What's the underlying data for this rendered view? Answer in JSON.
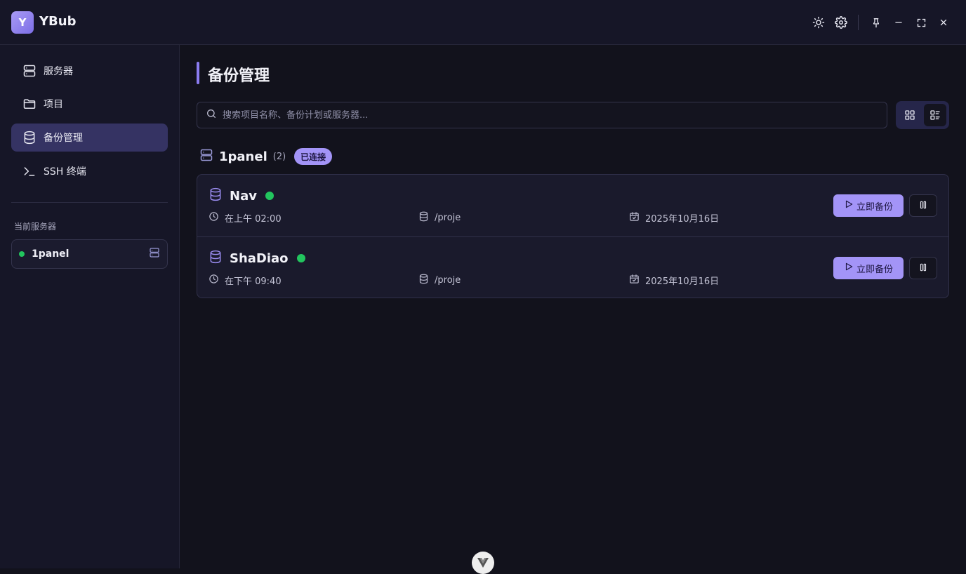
{
  "app": {
    "logo_letter": "Y",
    "name": "YBub"
  },
  "titlebar": {
    "icons": [
      "sun-icon",
      "gear-icon",
      "pin-icon",
      "minimize-icon",
      "fullscreen-icon",
      "close-icon"
    ]
  },
  "sidebar": {
    "items": [
      {
        "label": "服务器",
        "icon": "server-icon",
        "active": false
      },
      {
        "label": "项目",
        "icon": "folder-icon",
        "active": false
      },
      {
        "label": "备份管理",
        "icon": "database-icon",
        "active": true
      },
      {
        "label": "SSH 终端",
        "icon": "terminal-icon",
        "active": false
      }
    ],
    "current_server_label": "当前服务器",
    "current_server": {
      "name": "1panel",
      "status": "online"
    }
  },
  "main": {
    "title": "备份管理",
    "search": {
      "placeholder": "搜索项目名称、备份计划或服务器...",
      "value": ""
    },
    "view_mode": "list",
    "group": {
      "name": "1panel",
      "count": "(2)",
      "badge": "已连接",
      "rows": [
        {
          "name": "Nav",
          "status": "online",
          "schedule": "在上午 02:00",
          "path": "/projе",
          "date": "2025年10月16日",
          "backup_label": "立即备份"
        },
        {
          "name": "ShaDiao",
          "status": "online",
          "schedule": "在下午 09:40",
          "path": "/proje",
          "date": "2025年10月16日",
          "backup_label": "立即备份"
        }
      ]
    }
  },
  "colors": {
    "accent": "#a394f7",
    "status_online": "#22c55e",
    "active_nav": "#353363"
  }
}
